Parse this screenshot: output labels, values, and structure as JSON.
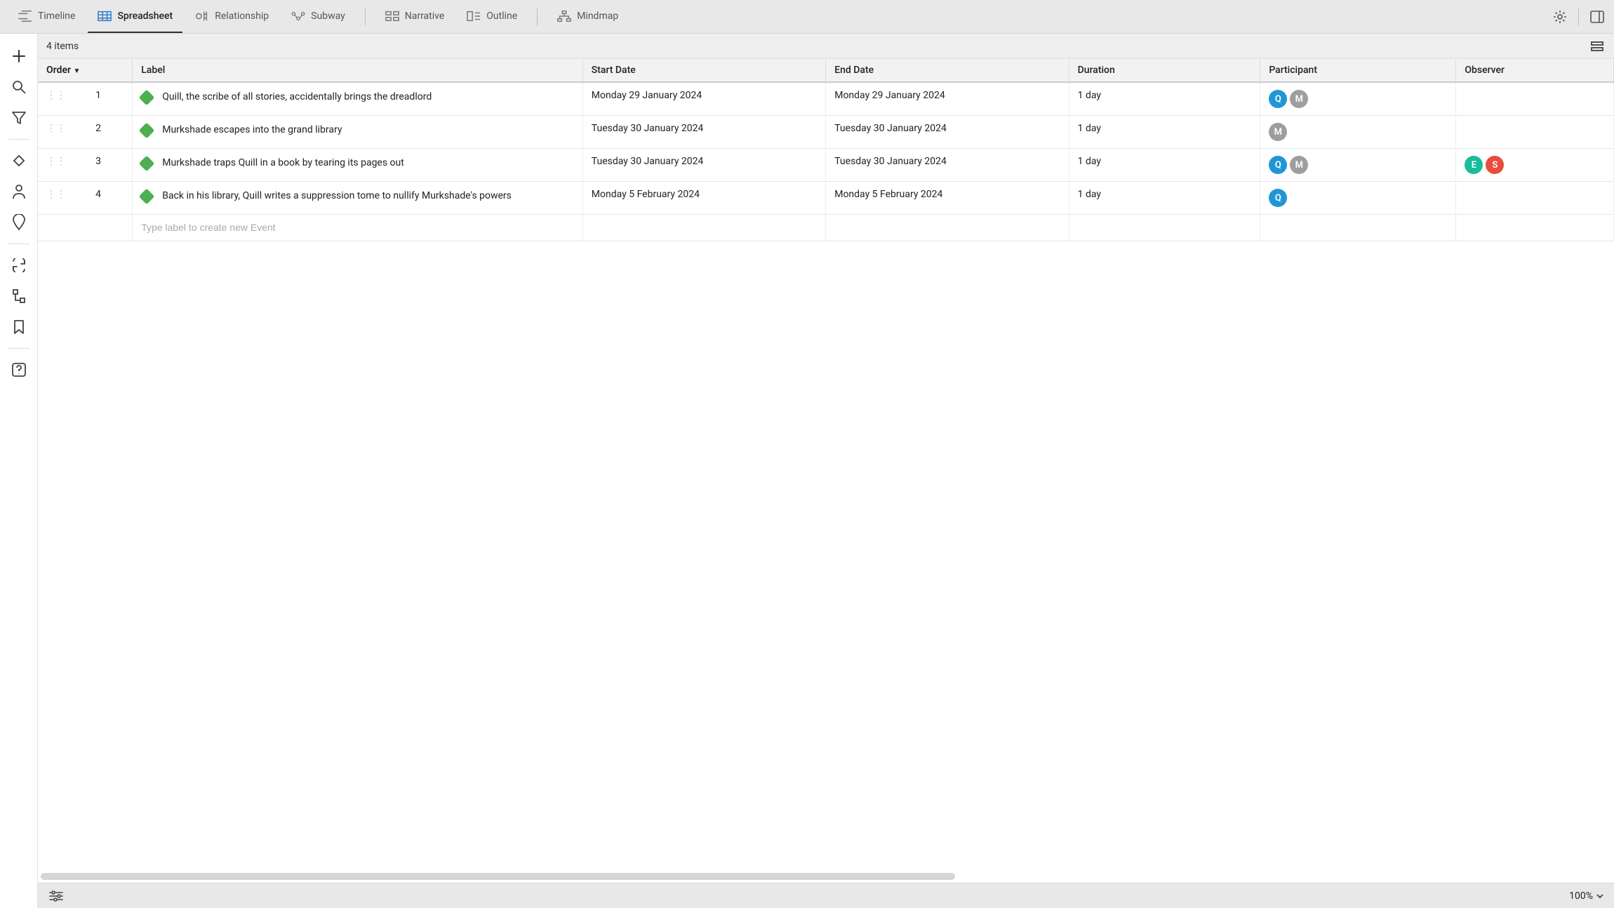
{
  "views": {
    "timeline": "Timeline",
    "spreadsheet": "Spreadsheet",
    "relationship": "Relationship",
    "subway": "Subway",
    "narrative": "Narrative",
    "outline": "Outline",
    "mindmap": "Mindmap"
  },
  "status": {
    "item_count": "4 items"
  },
  "columns": {
    "order": "Order",
    "label": "Label",
    "start": "Start Date",
    "end": "End Date",
    "duration": "Duration",
    "participant": "Participant",
    "observer": "Observer"
  },
  "rows": [
    {
      "order": "1",
      "label": "Quill, the scribe of all stories, accidentally brings the dreadlord",
      "start": "Monday 29 January 2024",
      "end": "Monday 29 January 2024",
      "duration": "1 day",
      "participants": [
        "Q",
        "M"
      ],
      "observers": []
    },
    {
      "order": "2",
      "label": "Murkshade escapes into the grand library",
      "start": "Tuesday 30 January 2024",
      "end": "Tuesday 30 January 2024",
      "duration": "1 day",
      "participants": [
        "M"
      ],
      "observers": []
    },
    {
      "order": "3",
      "label": "Murkshade traps Quill in a book by tearing its pages out",
      "start": "Tuesday 30 January 2024",
      "end": "Tuesday 30 January 2024",
      "duration": "1 day",
      "participants": [
        "Q",
        "M"
      ],
      "observers": [
        "E",
        "S"
      ]
    },
    {
      "order": "4",
      "label": "Back in his library, Quill writes a suppression tome to nullify Murkshade's powers",
      "start": "Monday 5 February 2024",
      "end": "Monday 5 February 2024",
      "duration": "1 day",
      "participants": [
        "Q"
      ],
      "observers": []
    }
  ],
  "new_event_placeholder": "Type label to create new Event",
  "zoom": "100%"
}
